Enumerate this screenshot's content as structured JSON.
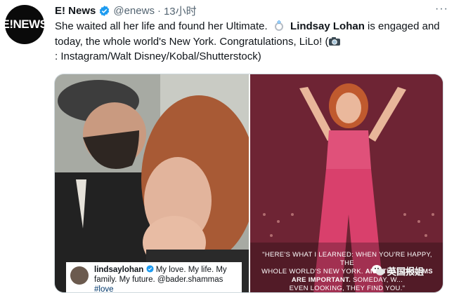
{
  "account": {
    "avatar_text": "E!NEWS",
    "name": "E! News",
    "handle": "@enews",
    "separator": "·",
    "time": "13小时",
    "more": "···"
  },
  "tweet": {
    "text_part1": "She waited all her life and found her Ultimate.",
    "text_bold": "Lindsay Lohan",
    "text_part2": "is engaged and today, the whole world's New York. Congratulations, LiLo! (",
    "text_part3": ": Instagram/Walt Disney/Kobal/Shutterstock)"
  },
  "media": {
    "instagram_caption": {
      "username": "lindsaylohan",
      "text": "My love. My life. My family. My future. @bader.shammas",
      "hashtag": "#love"
    },
    "movie_quote": {
      "line1": "\"HERE'S WHAT I LEARNED: WHEN YOU'RE HAPPY, THE",
      "line2": "WHOLE WORLD'S NEW YORK.",
      "line2_bold": "AND THAT DREAMS",
      "line3_bold": "ARE IMPORTANT.",
      "line3": "SOMEDAY, W...",
      "line4": "EVEN LOOKING, THEY FIND YOU.\""
    }
  },
  "watermark": {
    "text": "英国报姐"
  },
  "colors": {
    "verified": "#1d9bf0",
    "secondary_text": "#536471",
    "avatar_bg": "#0a0a0a"
  }
}
